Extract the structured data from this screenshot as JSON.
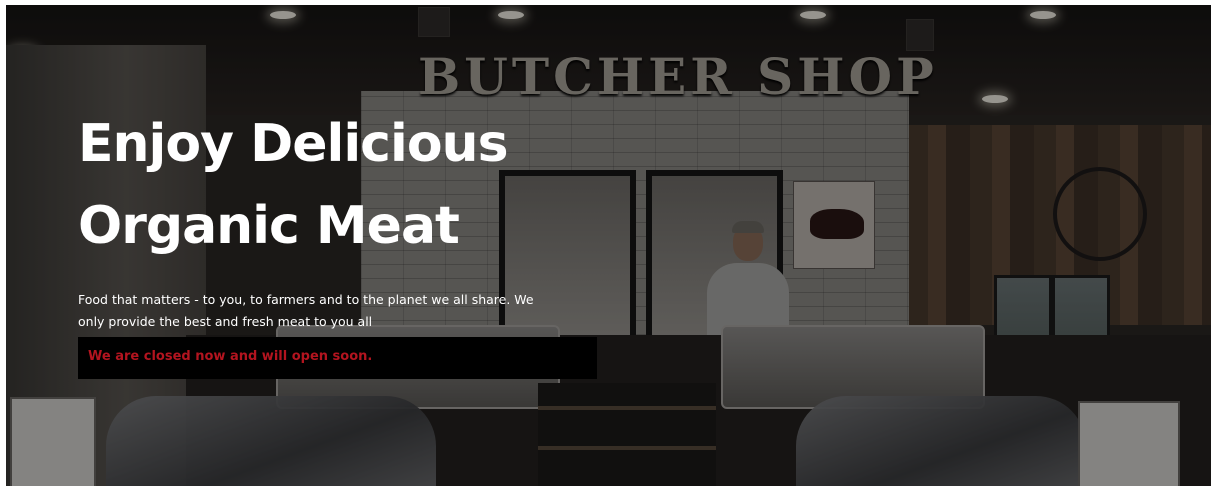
{
  "hero": {
    "headline_line1": "Enjoy Delicious",
    "headline_line2": "Organic Meat",
    "tagline": "Food that matters - to you, to farmers and to the planet we all share. We only provide the best and fresh meat to you all",
    "status_message": "We are closed now and will open soon.",
    "background_sign": "BUTCHER SHOP"
  },
  "colors": {
    "headline": "#ffffff",
    "tagline": "#ffffff",
    "status_bar_bg": "#000000",
    "status_text": "#b3141f"
  }
}
